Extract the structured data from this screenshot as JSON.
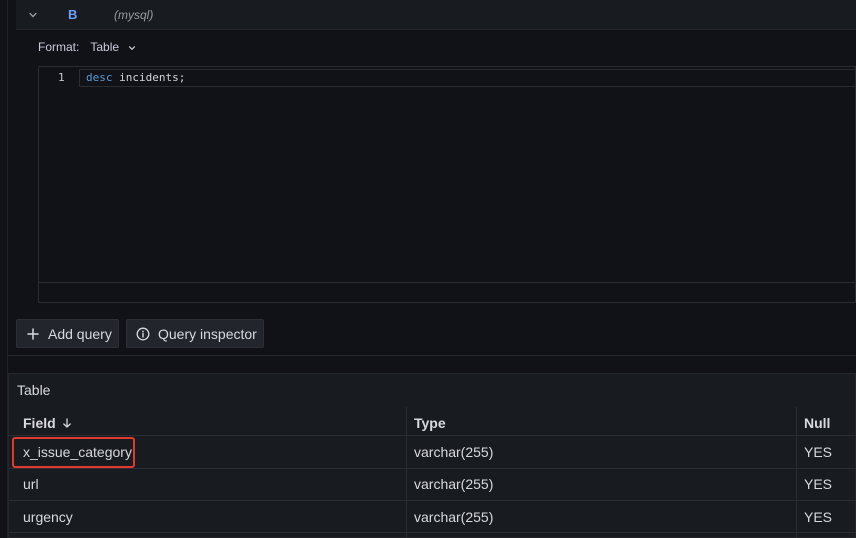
{
  "query": {
    "ref_id": "B",
    "datasource": "(mysql)",
    "format_label": "Format:",
    "format_value": "Table",
    "editor": {
      "line_number": "1",
      "keyword": "desc",
      "rest": " incidents;"
    }
  },
  "buttons": {
    "add_query": "Add query",
    "query_inspector": "Query inspector"
  },
  "table": {
    "title": "Table",
    "columns": [
      "Field",
      "Type",
      "Null"
    ],
    "rows": [
      {
        "field": "x_issue_category",
        "type": "varchar(255)",
        "null": "YES"
      },
      {
        "field": "url",
        "type": "varchar(255)",
        "null": "YES"
      },
      {
        "field": "urgency",
        "type": "varchar(255)",
        "null": "YES"
      }
    ],
    "sort_column": "Field",
    "sort_direction": "descending"
  },
  "colors": {
    "accent": "#6e9fff",
    "highlight": "#e03a2f",
    "background": "#111217"
  }
}
